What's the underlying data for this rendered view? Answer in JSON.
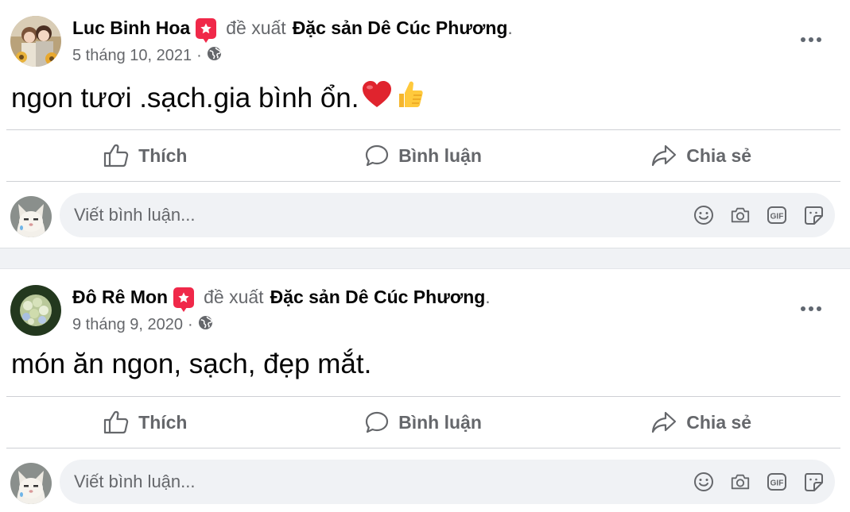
{
  "posts": [
    {
      "author": "Luc Binh Hoa",
      "suggest_text": "đề xuất",
      "page_name": "Đặc sản Dê Cúc Phương",
      "period": ".",
      "date": "5 tháng 10, 2021",
      "meta_sep": "·",
      "text": "ngon tươi .sạch.gia bình ổn.",
      "text_emojis": [
        "heart-emoji",
        "thumbs-up-emoji"
      ],
      "avatar": "couple-photo"
    },
    {
      "author": "Đô Rê Mon",
      "suggest_text": "đề xuất",
      "page_name": "Đặc sản Dê Cúc Phương",
      "period": ".",
      "date": "9 tháng 9, 2020",
      "meta_sep": "·",
      "text": "món ăn ngon, sạch, đẹp mắt.",
      "text_emojis": [],
      "avatar": "hydrangea-flower"
    }
  ],
  "actions": {
    "like": "Thích",
    "comment": "Bình luận",
    "share": "Chia sẻ"
  },
  "comment_box": {
    "placeholder": "Viết bình luận...",
    "icons": [
      "emoji-icon",
      "camera-icon",
      "gif-icon",
      "sticker-icon"
    ]
  },
  "colors": {
    "badge": "#f02849",
    "secondary_text": "#65676b",
    "input_bg": "#f0f2f5",
    "divider": "#ced0d4"
  }
}
